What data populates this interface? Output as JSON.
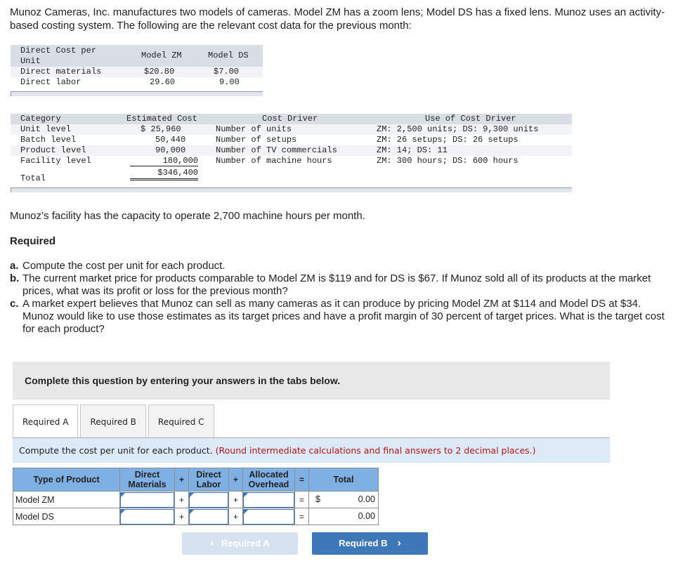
{
  "intro": "Munoz Cameras, Inc. manufactures two models of cameras. Model ZM has a zoom lens; Model DS has a fixed lens. Munoz uses an activity-based costing system. The following are the relevant cost data for the previous month:",
  "direct_cost_table": {
    "headers": [
      "Direct Cost per\nUnit",
      "Model ZM",
      "Model DS"
    ],
    "rows": [
      {
        "label": "Direct materials",
        "zm": "$20.80",
        "ds": "$7.00"
      },
      {
        "label": "Direct labor",
        "zm": "29.60",
        "ds": "9.00"
      }
    ]
  },
  "overhead_table": {
    "headers": [
      "Category",
      "Estimated Cost",
      "Cost Driver",
      "Use of Cost Driver"
    ],
    "rows": [
      {
        "category": "Unit level",
        "cost": "$ 25,960",
        "driver": "Number of units",
        "use": "ZM: 2,500 units; DS: 9,300 units"
      },
      {
        "category": "Batch level",
        "cost": "50,440",
        "driver": "Number of setups",
        "use": "ZM: 26 setups; DS: 26 setups"
      },
      {
        "category": "Product level",
        "cost": "90,000",
        "driver": "Number of TV commercials",
        "use": "ZM: 14; DS: 11"
      },
      {
        "category": "Facility level",
        "cost": "180,000",
        "driver": "Number of machine hours",
        "use": "ZM: 300 hours; DS: 600 hours"
      }
    ],
    "total_label": "Total",
    "total_value": "$346,400"
  },
  "capacity_text": "Munoz’s facility has the capacity to operate 2,700 machine hours per month.",
  "required_heading": "Required",
  "requirements": [
    {
      "letter": "a.",
      "text": "Compute the cost per unit for each product."
    },
    {
      "letter": "b.",
      "text": "The current market price for products comparable to Model ZM is $119 and for DS is $67. If Munoz sold all of its products at the market prices, what was its profit or loss for the previous month?"
    },
    {
      "letter": "c.",
      "text": "A market expert believes that Munoz can sell as many cameras as it can produce by pricing Model ZM at $114 and Model DS at $34. Munoz would like to use those estimates as its target prices and have a profit margin of 30 percent of target prices. What is the target cost for each product?"
    }
  ],
  "complete_prompt": "Complete this question by entering your answers in the tabs below.",
  "tabs": [
    {
      "label": "Required A",
      "active": true
    },
    {
      "label": "Required B",
      "active": false
    },
    {
      "label": "Required C",
      "active": false
    }
  ],
  "instruction": "Compute the cost per unit for each product.",
  "instruction_note": "(Round intermediate calculations and final answers to 2 decimal places.)",
  "answer_table": {
    "headers": {
      "type": "Type of Product",
      "dm": "Direct Materials",
      "dl": "Direct Labor",
      "oh": "Allocated Overhead",
      "total": "Total"
    },
    "plus": "+",
    "equals": "=",
    "rows": [
      {
        "label": "Model ZM",
        "dm": "",
        "dl": "",
        "oh": "",
        "currency": "$",
        "total": "0.00"
      },
      {
        "label": "Model DS",
        "dm": "",
        "dl": "",
        "oh": "",
        "currency": "",
        "total": "0.00"
      }
    ]
  },
  "nav": {
    "prev_label": "Required A",
    "next_label": "Required B",
    "prev_icon": "‹",
    "next_icon": "›"
  }
}
